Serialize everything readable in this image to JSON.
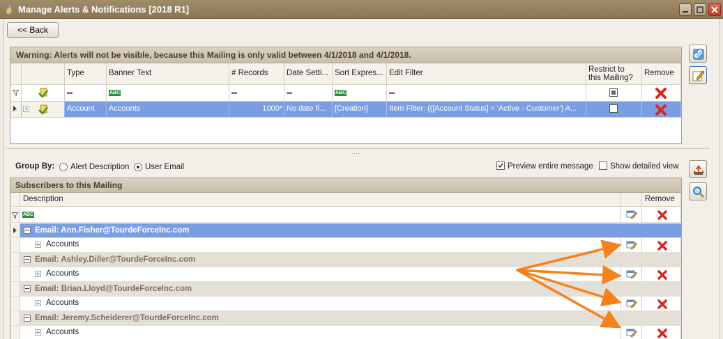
{
  "window": {
    "title": "Manage Alerts & Notifications [2018 R1]"
  },
  "toolbar": {
    "back_label": "<< Back"
  },
  "alerts_grid": {
    "warning": "Warning: Alerts will not be visible, because this Mailing is only valid between 4/1/2018 and 4/1/2018.",
    "columns": [
      "Type",
      "Banner Text",
      "# Records",
      "Date Setti...",
      "Sort Expres...",
      "Edit Filter",
      "Restrict to this Mailing?",
      "Remove"
    ],
    "restrict_line1": "Restrict to",
    "restrict_line2": "this Mailing?",
    "rows": [
      {
        "type": "Account",
        "banner_text": "Accounts",
        "records": "1000*",
        "date_setting": "No date fi...",
        "sort_expression": "[Creation]",
        "edit_filter": "Item Filter: (([Account Status] = 'Active - Customer') A...",
        "restrict": false
      }
    ]
  },
  "splitter": {
    "grip": "...."
  },
  "group_by": {
    "label": "Group By:",
    "options": [
      "Alert Description",
      "User Email"
    ],
    "selected": "User Email"
  },
  "view_options": {
    "preview_entire_label": "Preview entire message",
    "preview_entire_checked": true,
    "show_detailed_label": "Show detailed view",
    "show_detailed_checked": false
  },
  "subscribers": {
    "title": "Subscribers to this Mailing",
    "columns": {
      "description": "Description",
      "remove": "Remove"
    },
    "groups": [
      {
        "label": "Email: Ann.Fisher@TourdeForceInc.com",
        "child": "Accounts"
      },
      {
        "label": "Email: Ashley.Diller@TourdeForceInc.com",
        "child": "Accounts"
      },
      {
        "label": "Email: Brian.Lloyd@TourdeForceInc.com",
        "child": "Accounts"
      },
      {
        "label": "Email: Jeremy.Scheiderer@TourdeForceInc.com",
        "child": "Accounts"
      }
    ]
  },
  "colors": {
    "selection": "#7b9ee3",
    "header_band": "#d0c7b6",
    "annotation_arrow": "#f5821f",
    "remove_red": "#d42a1e"
  },
  "icons": [
    "app-flame-icon",
    "minimize-icon",
    "maximize-icon",
    "close-icon",
    "link-icon",
    "edit-pencil-icon",
    "alert-bell-icon",
    "magnifier-icon",
    "filter-funnel-icon",
    "alert-type-icon",
    "abc-text-icon",
    "remove-x-icon",
    "edit-row-icon"
  ]
}
